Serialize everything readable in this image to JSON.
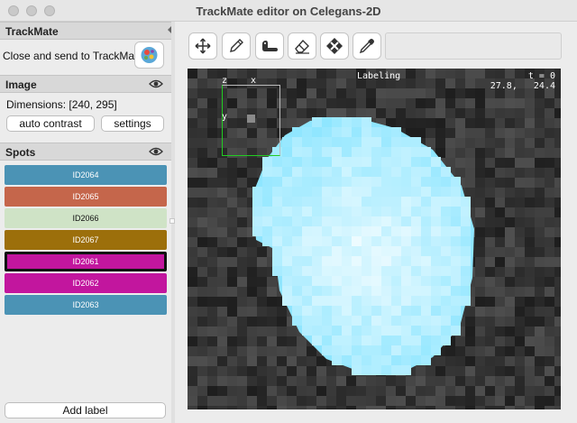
{
  "window": {
    "title": "TrackMate editor on Celegans-2D"
  },
  "trackmate": {
    "header": "TrackMate",
    "close_send_label": "Close and send to TrackMate"
  },
  "image": {
    "header": "Image",
    "dimensions": "Dimensions: [240, 295]",
    "auto_contrast_label": "auto contrast",
    "settings_label": "settings"
  },
  "spots": {
    "header": "Spots",
    "items": [
      {
        "label": "ID2064",
        "color": "#4b93b5",
        "text_color": "#ffffff"
      },
      {
        "label": "ID2065",
        "color": "#c5664b",
        "text_color": "#ffffff"
      },
      {
        "label": "ID2066",
        "color": "#cfe3c6",
        "text_color": "#111111"
      },
      {
        "label": "ID2067",
        "color": "#9c6f0b",
        "text_color": "#ffffff"
      },
      {
        "label": "ID2061",
        "color": "#c2169e",
        "text_color": "#ffffff",
        "selected": true
      },
      {
        "label": "ID2062",
        "color": "#c2169e",
        "text_color": "#ffffff"
      },
      {
        "label": "ID2063",
        "color": "#4b93b5",
        "text_color": "#ffffff"
      }
    ],
    "add_label": "Add label"
  },
  "toolbar": {
    "icons": [
      "move-icon",
      "pencil-icon",
      "fill-icon",
      "eraser-icon",
      "clear-icon",
      "eyedropper-icon"
    ]
  },
  "viewer": {
    "labeling": "Labeling",
    "time": "t = 0",
    "coords": "27.8,   24.4",
    "axis_z": "z",
    "axis_x": "x",
    "axis_y": "y",
    "blob_color": "#8fe6ff",
    "overview_border_color": "#22cc22"
  }
}
